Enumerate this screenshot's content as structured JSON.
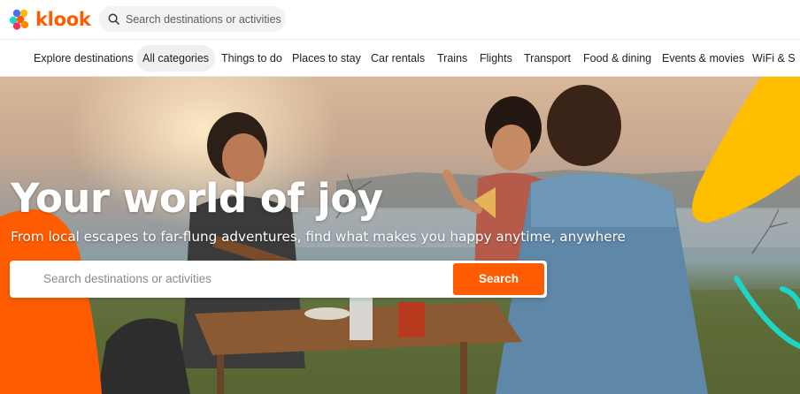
{
  "brand": {
    "name": "klook",
    "color": "#ff5b00"
  },
  "header": {
    "search_placeholder": "Search destinations or activities",
    "search_icon": "search-icon"
  },
  "categories": [
    {
      "label": "Explore destinations",
      "active": false
    },
    {
      "label": "All categories",
      "active": true
    },
    {
      "label": "Things to do",
      "active": false
    },
    {
      "label": "Places to stay",
      "active": false
    },
    {
      "label": "Car rentals",
      "active": false
    },
    {
      "label": "Trains",
      "active": false
    },
    {
      "label": "Flights",
      "active": false
    },
    {
      "label": "Transport",
      "active": false
    },
    {
      "label": "Food & dining",
      "active": false
    },
    {
      "label": "Events & movies",
      "active": false
    },
    {
      "label": "WiFi & S",
      "active": false
    }
  ],
  "hero": {
    "title": "Your world of joy",
    "subtitle": "From local escapes to far-flung adventures, find what makes you happy anytime, anywhere",
    "search_placeholder": "Search destinations or activities",
    "search_button": "Search",
    "accent_colors": {
      "orange": "#ff5b00",
      "yellow": "#ffbd00",
      "teal": "#1ed6c8"
    }
  }
}
